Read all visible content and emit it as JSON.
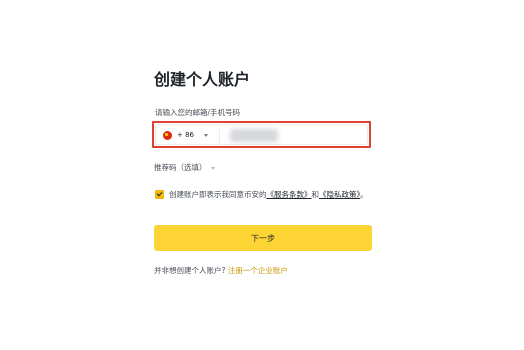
{
  "page": {
    "title": "创建个人账户"
  },
  "form": {
    "field_label": "请输入您的邮箱/手机号码",
    "country": {
      "flag": "china-flag-icon",
      "dial_code": "+ 86"
    },
    "phone_value": "",
    "referral_label": "推荐码（选填）",
    "agreement": {
      "checked": true,
      "prefix": "创建账户即表示我同意币安的",
      "terms_link": "《服务条款》",
      "conjunction": "和",
      "privacy_link": "《隐私政策》",
      "suffix": "。"
    },
    "next_button": "下一步"
  },
  "footer": {
    "question": "并非想创建个人账户? ",
    "enterprise_link": "注册一个企业账户"
  },
  "colors": {
    "accent_yellow": "#fcd535",
    "checkbox_yellow": "#f0b90b",
    "link_gold": "#c99400",
    "error_outline": "#e0412e",
    "text_primary": "#1e2329",
    "text_secondary": "#474d57"
  }
}
